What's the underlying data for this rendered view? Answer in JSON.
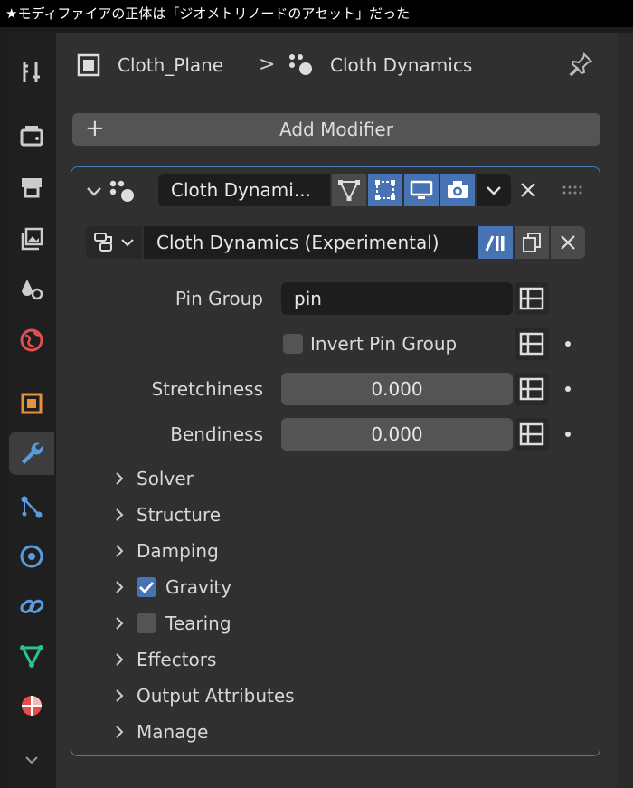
{
  "caption": "★モディファイアの正体は「ジオメトリノードのアセット」だった",
  "header": {
    "object_name": "Cloth_Plane",
    "separator": ">",
    "modifier_name": "Cloth Dynamics"
  },
  "add_modifier": {
    "plus": "+",
    "label": "Add Modifier"
  },
  "modifier": {
    "name": "Cloth Dynami...",
    "node_group": "Cloth Dynamics (Experimental)",
    "properties": {
      "pin_group_label": "Pin Group",
      "pin_group_value": "pin",
      "invert_pin_group_label": "Invert Pin Group",
      "stretchiness_label": "Stretchiness",
      "stretchiness_value": "0.000",
      "bendiness_label": "Bendiness",
      "bendiness_value": "0.000"
    },
    "subpanels": {
      "solver": "Solver",
      "structure": "Structure",
      "damping": "Damping",
      "gravity": "Gravity",
      "tearing": "Tearing",
      "effectors": "Effectors",
      "output_attributes": "Output Attributes",
      "manage": "Manage"
    }
  },
  "colors": {
    "accent": "#4772b3",
    "outline": "#4a7ab8",
    "panel": "#303030"
  }
}
